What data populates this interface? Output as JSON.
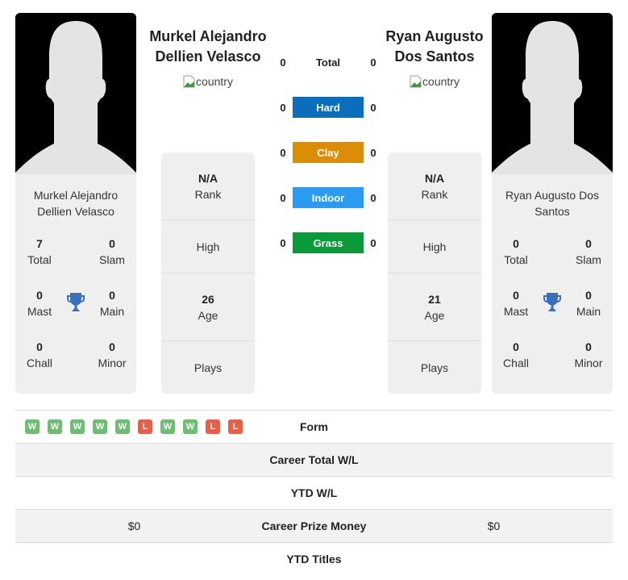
{
  "colors": {
    "hard": "#0a6ebd",
    "clay": "#db8d05",
    "indoor": "#2b9af3",
    "grass": "#0b9a3a",
    "win": "#6ebd72",
    "loss": "#e85f48",
    "trophy": "#3a6fc0"
  },
  "player1": {
    "name": "Murkel Alejandro Dellien Velasco",
    "country_alt": "country",
    "card_name": "Murkel Alejandro Dellien Velasco",
    "titles": {
      "total": {
        "value": "7",
        "label": "Total"
      },
      "slam": {
        "value": "0",
        "label": "Slam"
      },
      "mast": {
        "value": "0",
        "label": "Mast"
      },
      "main": {
        "value": "0",
        "label": "Main"
      },
      "chall": {
        "value": "0",
        "label": "Chall"
      },
      "minor": {
        "value": "0",
        "label": "Minor"
      }
    },
    "rank": {
      "value": "N/A",
      "label": "Rank"
    },
    "high": {
      "label": "High"
    },
    "age": {
      "value": "26",
      "label": "Age"
    },
    "plays": {
      "label": "Plays"
    }
  },
  "player2": {
    "name": "Ryan Augusto Dos Santos",
    "country_alt": "country",
    "card_name": "Ryan Augusto Dos Santos",
    "titles": {
      "total": {
        "value": "0",
        "label": "Total"
      },
      "slam": {
        "value": "0",
        "label": "Slam"
      },
      "mast": {
        "value": "0",
        "label": "Mast"
      },
      "main": {
        "value": "0",
        "label": "Main"
      },
      "chall": {
        "value": "0",
        "label": "Chall"
      },
      "minor": {
        "value": "0",
        "label": "Minor"
      }
    },
    "rank": {
      "value": "N/A",
      "label": "Rank"
    },
    "high": {
      "label": "High"
    },
    "age": {
      "value": "21",
      "label": "Age"
    },
    "plays": {
      "label": "Plays"
    }
  },
  "h2h": {
    "total": {
      "label": "Total",
      "p1": "0",
      "p2": "0"
    },
    "hard": {
      "label": "Hard",
      "p1": "0",
      "p2": "0"
    },
    "clay": {
      "label": "Clay",
      "p1": "0",
      "p2": "0"
    },
    "indoor": {
      "label": "Indoor",
      "p1": "0",
      "p2": "0"
    },
    "grass": {
      "label": "Grass",
      "p1": "0",
      "p2": "0"
    }
  },
  "table": {
    "form": {
      "label": "Form",
      "p1": [
        "W",
        "W",
        "W",
        "W",
        "W",
        "L",
        "W",
        "W",
        "L",
        "L"
      ]
    },
    "career_wl": {
      "label": "Career Total W/L",
      "p1": "",
      "p2": ""
    },
    "ytd_wl": {
      "label": "YTD W/L",
      "p1": "",
      "p2": ""
    },
    "prize": {
      "label": "Career Prize Money",
      "p1": "$0",
      "p2": "$0"
    },
    "ytd_titles": {
      "label": "YTD Titles",
      "p1": "",
      "p2": ""
    }
  }
}
